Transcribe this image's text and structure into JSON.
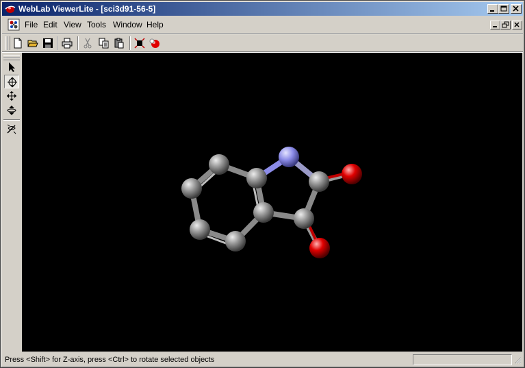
{
  "window": {
    "title": "WebLab ViewerLite - [sci3d91-56-5]",
    "controls": [
      "minimize",
      "maximize",
      "close"
    ]
  },
  "menubar": {
    "items": [
      {
        "label": "File"
      },
      {
        "label": "Edit"
      },
      {
        "label": "View"
      },
      {
        "label": "Tools"
      },
      {
        "label": "Window"
      },
      {
        "label": "Help"
      }
    ],
    "mdi_controls": [
      "minimize",
      "restore",
      "close"
    ]
  },
  "toolbar": {
    "buttons": [
      "new-icon",
      "open-icon",
      "save-icon",
      "print-icon",
      "cut-icon",
      "copy-icon",
      "paste-icon",
      "fit-to-screen-icon",
      "render-style-icon"
    ]
  },
  "tools_palette": {
    "buttons": [
      "select-tool-icon",
      "rotate-tool-icon",
      "translate-tool-icon",
      "zoom-tool-icon",
      "z-rotate-tool-icon"
    ],
    "active": "rotate-tool-icon"
  },
  "viewport": {
    "background": "#000000",
    "atom_colors": {
      "carbon": "#9a9a9a",
      "nitrogen": "#8c8ce8",
      "oxygen": "#e00000"
    }
  },
  "statusbar": {
    "message": "Press <Shift> for Z-axis, press <Ctrl> to rotate selected objects"
  }
}
